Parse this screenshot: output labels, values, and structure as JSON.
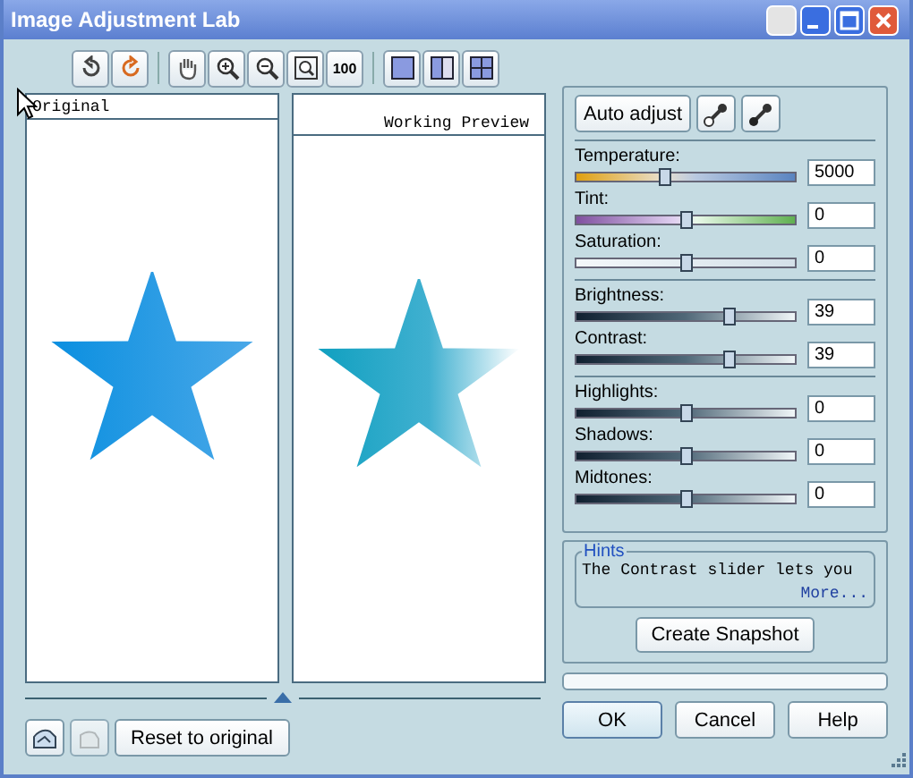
{
  "window": {
    "title": "Image Adjustment Lab"
  },
  "toolbar": [
    {
      "kind": "rotate-left"
    },
    {
      "kind": "rotate-right"
    },
    {
      "kind": "sep"
    },
    {
      "kind": "hand"
    },
    {
      "kind": "zoom-in"
    },
    {
      "kind": "zoom-out"
    },
    {
      "kind": "zoom-fit"
    },
    {
      "kind": "zoom-100",
      "label": "100"
    },
    {
      "kind": "sep"
    },
    {
      "kind": "single"
    },
    {
      "kind": "split"
    },
    {
      "kind": "quad"
    }
  ],
  "preview": {
    "left_label": "Original",
    "right_label": "Working Preview"
  },
  "auto_adjust": "Auto adjust",
  "slider_groups": [
    [
      {
        "name": "Temperature:",
        "kind": "temperature",
        "level": 0.4,
        "value": "5000"
      },
      {
        "name": "Tint:",
        "kind": "tint",
        "level": 0.5,
        "value": "0"
      },
      {
        "name": "Saturation:",
        "kind": "plain",
        "level": 0.5,
        "value": "0"
      }
    ],
    [
      {
        "name": "Brightness:",
        "kind": "dark",
        "level": 0.7,
        "value": "39"
      },
      {
        "name": "Contrast:",
        "kind": "dark",
        "level": 0.7,
        "value": "39"
      }
    ],
    [
      {
        "name": "Highlights:",
        "kind": "dark",
        "level": 0.5,
        "value": "0"
      },
      {
        "name": "Shadows:",
        "kind": "dark",
        "level": 0.5,
        "value": "0"
      },
      {
        "name": "Midtones:",
        "kind": "dark",
        "level": 0.5,
        "value": "0"
      }
    ]
  ],
  "hints": {
    "title": "Hints",
    "text": "The Contrast slider lets you",
    "more": "More..."
  },
  "create_snapshot": "Create Snapshot",
  "progress": {
    "level": 0
  },
  "reset": "Reset to original",
  "buttons": [
    "OK",
    "Cancel",
    "Help"
  ]
}
